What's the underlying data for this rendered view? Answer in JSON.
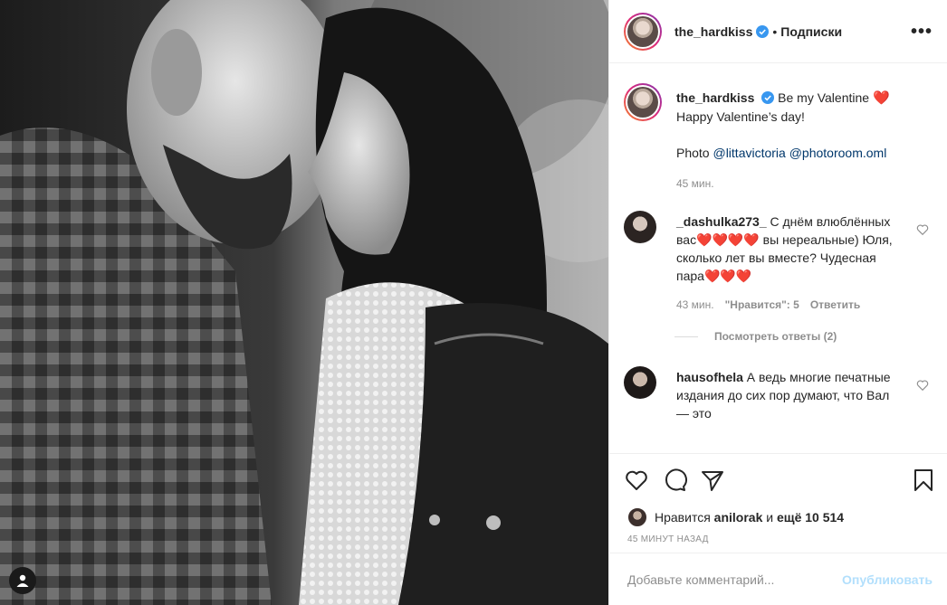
{
  "header": {
    "username": "the_hardkiss",
    "separator": "•",
    "follow_label": "Подписки",
    "more_label": "•••"
  },
  "caption": {
    "username": "the_hardkiss",
    "text_1": "Be my Valentine",
    "emoji": "❤️",
    "text_2": "Happy Valentine’s day!",
    "photo_prefix": "Photo",
    "mention_1": "@littavictoria",
    "mention_2": "@photoroom.oml",
    "time": "45 мин."
  },
  "comments": [
    {
      "username": "_dashulka273_",
      "text": "С днём влюблённых вас❤️❤️❤️❤️ вы нереальные) Юля, сколько лет вы вместе? Чудесная пара❤️❤️❤️",
      "time": "43 мин.",
      "likes": "\"Нравится\": 5",
      "reply_label": "Ответить",
      "view_replies": "Посмотреть ответы (2)"
    },
    {
      "username": "hausofhela",
      "text": "А ведь многие печатные издания до сих пор думают, что Вал — это"
    }
  ],
  "likes": {
    "prefix": "Нравится",
    "user": "anilorak",
    "middle": "и",
    "others": "ещё 10 514"
  },
  "time_ago": "45 МИНУТ НАЗАД",
  "add_comment": {
    "placeholder": "Добавьте комментарий...",
    "publish_label": "Опубликовать"
  },
  "colors": {
    "verified": "#3897f0",
    "heart": "#e0112b",
    "publish_disabled": "#b2dffc",
    "mention": "#00376b",
    "muted": "#8e8e8e"
  },
  "icons": [
    "user-tag-icon",
    "verified-icon",
    "more-icon",
    "heart-icon",
    "comment-icon",
    "share-icon",
    "bookmark-icon"
  ]
}
